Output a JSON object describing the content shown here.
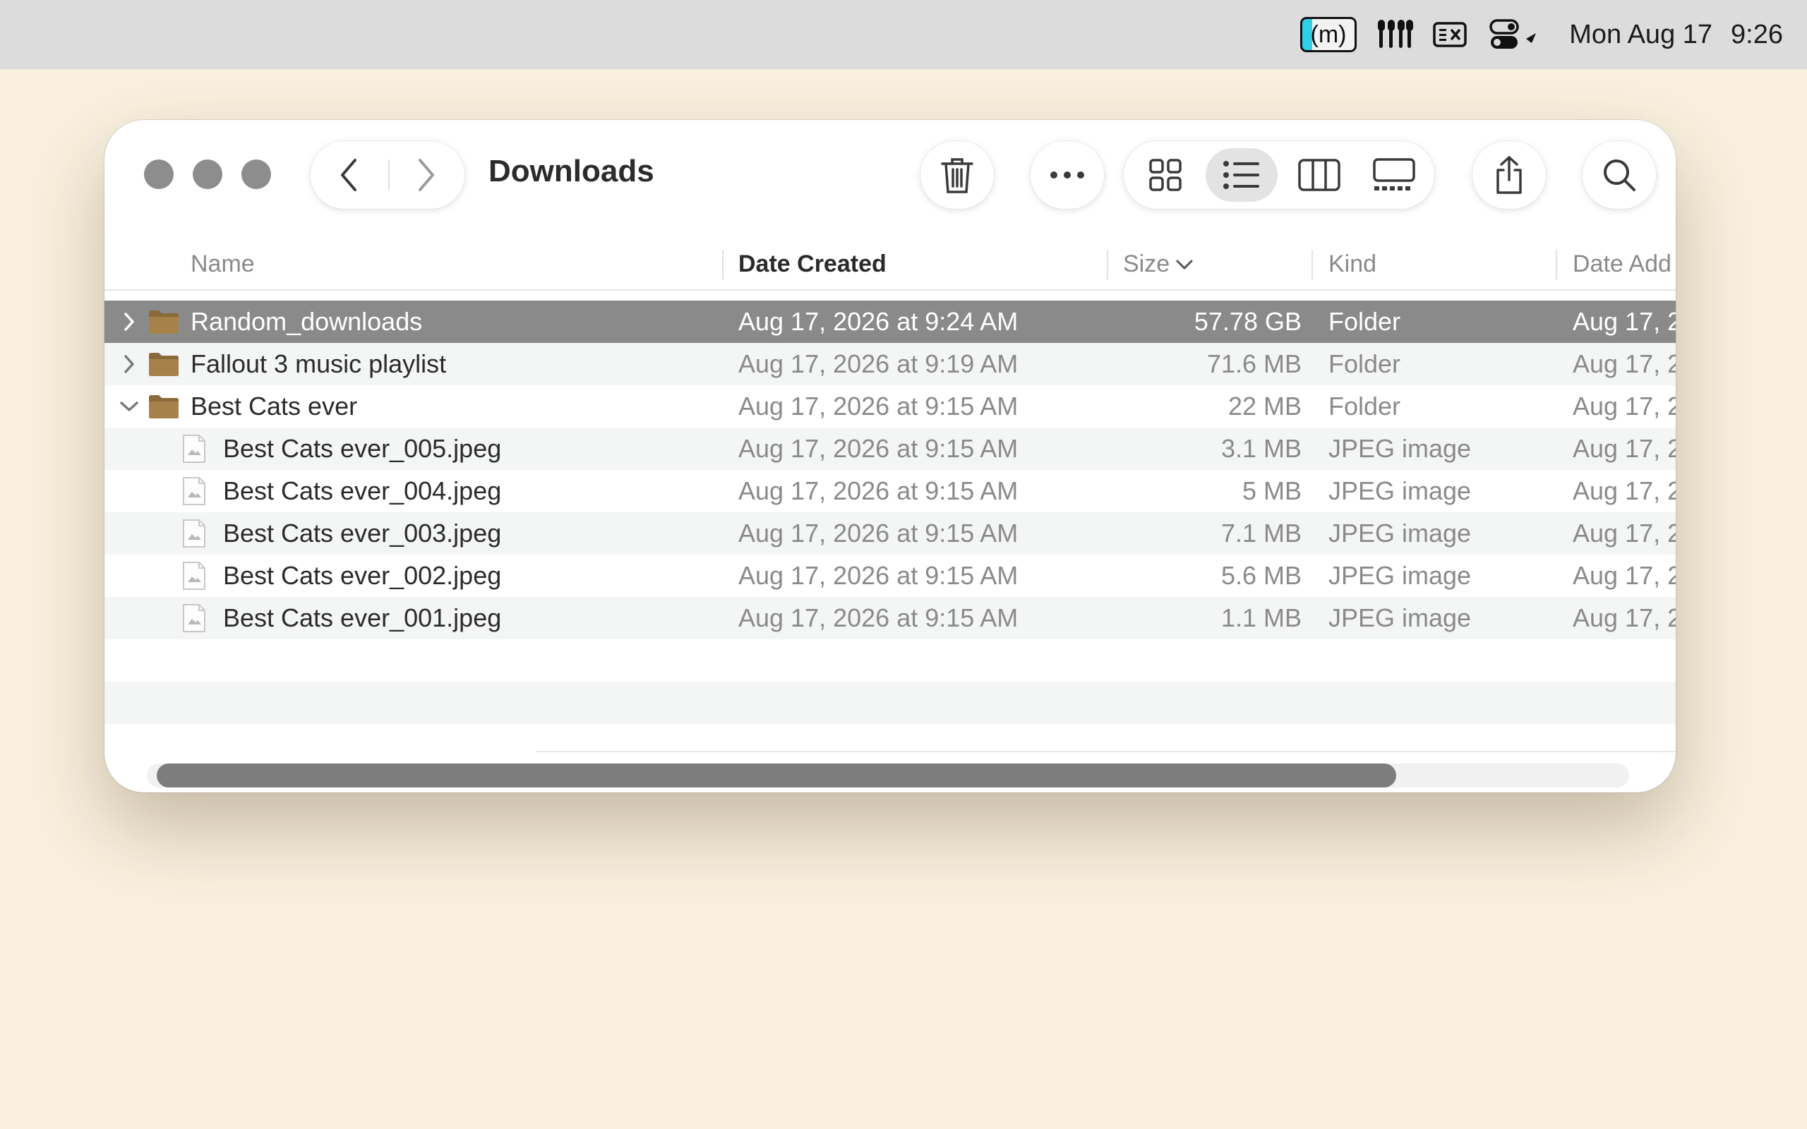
{
  "menubar": {
    "app_badge": "(m)",
    "day": "Mon Aug 17",
    "time": "9:26"
  },
  "window": {
    "title": "Downloads",
    "icons": {
      "back": "chevron-left-icon",
      "forward": "chevron-right-icon",
      "trash": "trash-icon",
      "more": "ellipsis-icon",
      "icon_view": "grid-icon",
      "list_view": "list-icon",
      "column_view": "columns-icon",
      "gallery_view": "gallery-icon",
      "share": "share-icon",
      "search": "search-icon"
    },
    "active_view": "list",
    "columns": {
      "name": "Name",
      "date_created": "Date Created",
      "size": "Size",
      "kind": "Kind",
      "date_added": "Date Add"
    },
    "sort_column": "Date Created",
    "rows": [
      {
        "name": "Random_downloads",
        "date": "Aug 17, 2026 at 9:24 AM",
        "size": "57.78 GB",
        "kind": "Folder",
        "added": "Aug 17, 2",
        "type": "folder",
        "expanded": false,
        "selected": true
      },
      {
        "name": "Fallout 3 music playlist",
        "date": "Aug 17, 2026 at 9:19 AM",
        "size": "71.6 MB",
        "kind": "Folder",
        "added": "Aug 17, 2",
        "type": "folder",
        "expanded": false,
        "selected": false
      },
      {
        "name": "Best Cats ever",
        "date": "Aug 17, 2026 at 9:15 AM",
        "size": "22 MB",
        "kind": "Folder",
        "added": "Aug 17, 2",
        "type": "folder",
        "expanded": true,
        "selected": false
      },
      {
        "name": "Best Cats ever_005.jpeg",
        "date": "Aug 17, 2026 at 9:15 AM",
        "size": "3.1 MB",
        "kind": "JPEG image",
        "added": "Aug 17, 2",
        "type": "file",
        "selected": false
      },
      {
        "name": "Best Cats ever_004.jpeg",
        "date": "Aug 17, 2026 at 9:15 AM",
        "size": "5 MB",
        "kind": "JPEG image",
        "added": "Aug 17, 2",
        "type": "file",
        "selected": false
      },
      {
        "name": "Best Cats ever_003.jpeg",
        "date": "Aug 17, 2026 at 9:15 AM",
        "size": "7.1 MB",
        "kind": "JPEG image",
        "added": "Aug 17, 2",
        "type": "file",
        "selected": false
      },
      {
        "name": "Best Cats ever_002.jpeg",
        "date": "Aug 17, 2026 at 9:15 AM",
        "size": "5.6 MB",
        "kind": "JPEG image",
        "added": "Aug 17, 2",
        "type": "file",
        "selected": false
      },
      {
        "name": "Best Cats ever_001.jpeg",
        "date": "Aug 17, 2026 at 9:15 AM",
        "size": "1.1 MB",
        "kind": "JPEG image",
        "added": "Aug 17, 2",
        "type": "file",
        "selected": false
      }
    ],
    "horizontal_scroll_fraction": 0.84
  },
  "colors": {
    "desktop": "#f9f0df",
    "menubar": "#dcdcdc",
    "selection": "#8a8a8a",
    "folder": "#8a6a3a"
  }
}
